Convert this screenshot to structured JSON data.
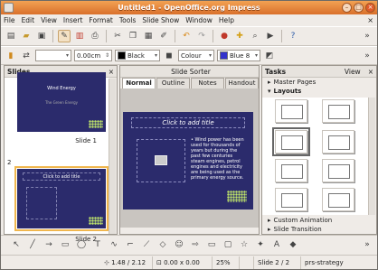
{
  "window": {
    "title": "Untitled1 - OpenOffice.org Impress",
    "min": "–",
    "max": "□",
    "close": "×"
  },
  "menu": [
    "File",
    "Edit",
    "View",
    "Insert",
    "Format",
    "Tools",
    "Slide Show",
    "Window",
    "Help"
  ],
  "menu_close": "×",
  "toolbar2": {
    "line_width": "0.00cm",
    "line_color": "Black",
    "fill_type": "Colour",
    "fill_color": "Blue 8"
  },
  "colors": {
    "black": "#000000",
    "blue8": "#3333cc"
  },
  "slides_pane": {
    "title": "Slides",
    "close": "×",
    "slide1": {
      "title": "Wind Energy",
      "subtitle": "The Green Energy",
      "label": "Slide 1"
    },
    "slide2": {
      "number": "2",
      "title": "Click to add title",
      "label": "Slide 2"
    }
  },
  "editor": {
    "header": "Slide Sorter",
    "tabs": [
      "Normal",
      "Outline",
      "Notes",
      "Handout"
    ],
    "slide_title_placeholder": "Click to add title",
    "body_text": "• Wind power has been used for thousands of years but during the past few centuries steam engines, petrol engines and electricity are being used as the primary energy source."
  },
  "tasks": {
    "title": "Tasks",
    "view": "View",
    "close": "×",
    "master_pages": "Master Pages",
    "layouts": "Layouts",
    "custom_animation": "Custom Animation",
    "slide_transition": "Slide Transition"
  },
  "status": {
    "position": "1.48 / 2.12",
    "size": "0.00 x 0.00",
    "zoom": "25%",
    "slide": "Slide 2 / 2",
    "template": "prs-strategy"
  }
}
